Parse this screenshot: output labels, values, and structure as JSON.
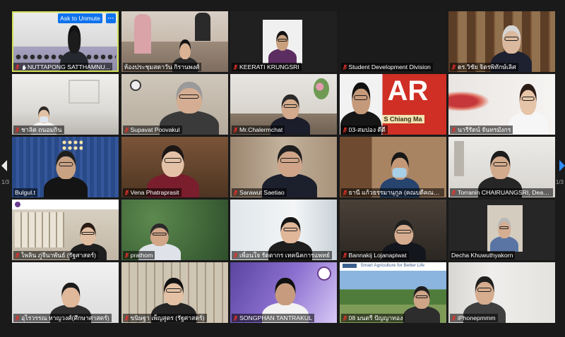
{
  "colors": {
    "active_speaker_border": "#d3e158",
    "button_blue": "#0e72ed",
    "muted_mic": "#e5312b",
    "next_arrow": "#2d8cff"
  },
  "icons": {
    "muted": "mic-off-icon",
    "hand": "raised-hand-icon",
    "prev": "chevron-left-icon",
    "next": "chevron-right-icon"
  },
  "active_tile": {
    "ask_to_unmute": "Ask to Unmute",
    "more": "···"
  },
  "pager": {
    "left": "1/3",
    "right": "1/3"
  },
  "tiles": [
    {
      "name": "NUTTAPONG SATTHAMNU...",
      "muted": true,
      "hand": true,
      "active_speaker": true
    },
    {
      "name": "ห้องประชุมสดาวัน กิรานพงศ์",
      "muted": false
    },
    {
      "name": "KEERATI KRUNGSRI",
      "muted": true
    },
    {
      "name": "Student Development Division",
      "muted": true
    },
    {
      "name": "ดร.วิชัย จิตรพิทักษ์เลิศ",
      "muted": true
    },
    {
      "name": "ชาลิต ถนอมกิน",
      "muted": true
    },
    {
      "name": "Supavat Poovakul",
      "muted": true
    },
    {
      "name": "Mr.Chalermchat",
      "muted": true
    },
    {
      "name": "03-สมปอง ดีดี",
      "muted": true,
      "sign": {
        "main": "AR",
        "sub": "S Chiang Ma"
      }
    },
    {
      "name": "นารีรัตน์ จันทรมังกร",
      "muted": true
    },
    {
      "name": "Bulgul.t",
      "muted": false
    },
    {
      "name": "Vena Phatraprasit",
      "muted": true
    },
    {
      "name": "Sarawut Saetiao",
      "muted": true
    },
    {
      "name": "ธานี แก้วธรรมานุกูล (คณบดีคณพย...",
      "muted": true
    },
    {
      "name": "Torranin CHAIRUANGSRI, Dean...",
      "muted": true
    },
    {
      "name": "ไพลิน ภู่จีนาพันธ์ (รัฐศาสตร์)",
      "muted": true
    },
    {
      "name": "prathom",
      "muted": true
    },
    {
      "name": "เพื่อนใจ รัตตากร เทคนิคการแพทย์",
      "muted": true
    },
    {
      "name": "Bannakij Lojanapiwat",
      "muted": true
    },
    {
      "name": "Decha Khuwuthyakorn",
      "muted": false
    },
    {
      "name": "อุไรวรรณ หาญวงศ์(ศึกษาศาสตร์)",
      "muted": true
    },
    {
      "name": "ขนิษฐา เพ็ญสูตร (รัฐศาสตร์)",
      "muted": true
    },
    {
      "name": "SONGPHAN TANTRAKUL",
      "muted": true
    },
    {
      "name": "08 มนตรี ปัญญาทอง",
      "muted": true,
      "sign": {
        "sub": "Smart Agriculture for Better Life"
      }
    },
    {
      "name": "iPhonepmmm",
      "muted": true
    }
  ]
}
